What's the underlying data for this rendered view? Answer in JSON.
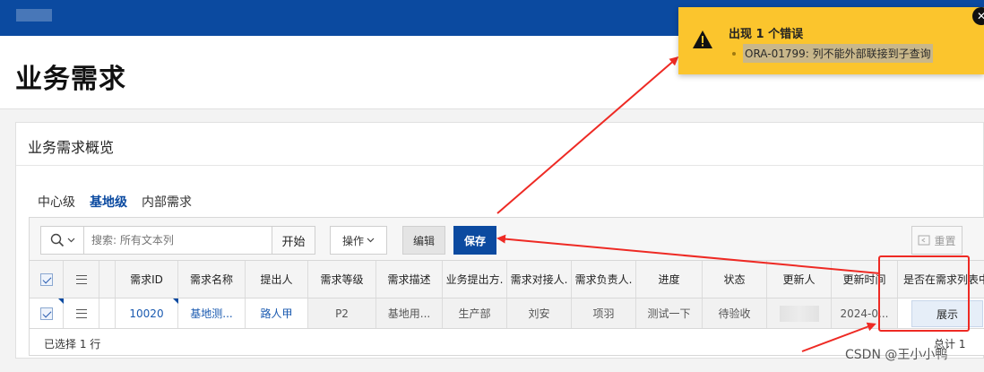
{
  "page": {
    "title": "业务需求"
  },
  "region": {
    "title": "业务需求概览",
    "tabs": [
      {
        "label": "中心级",
        "active": false
      },
      {
        "label": "基地级",
        "active": true
      },
      {
        "label": "内部需求",
        "active": false
      }
    ]
  },
  "toolbar": {
    "search_placeholder": "搜索: 所有文本列",
    "go_label": "开始",
    "actions_label": "操作",
    "edit_label": "编辑",
    "save_label": "保存",
    "reset_label": "重置"
  },
  "grid": {
    "columns": [
      "需求ID",
      "需求名称",
      "提出人",
      "需求等级",
      "需求描述",
      "业务提出方.",
      "需求对接人.",
      "需求负责人.",
      "进度",
      "状态",
      "更新人",
      "更新时间",
      "是否在需求列表中"
    ],
    "row": {
      "id": "10020",
      "name": "基地测...",
      "proposer": "路人甲",
      "level": "P2",
      "description": "基地用...",
      "business_party": "生产部",
      "contact": "刘安",
      "owner": "项羽",
      "progress": "测试一下",
      "status": "待验收",
      "updated_by": "",
      "updated_time": "2024-0...",
      "in_list_label": "展示"
    },
    "selected_text": "已选择 1 行",
    "total_text": "总计 1"
  },
  "toast": {
    "title": "出现 1 个错误",
    "message": "ORA-01799: 列不能外部联接到子查询"
  },
  "watermark": "CSDN @王小小鸭",
  "colors": {
    "brand": "#0b4aa0",
    "warning": "#fbc52d",
    "annotation": "#ee2a24"
  }
}
